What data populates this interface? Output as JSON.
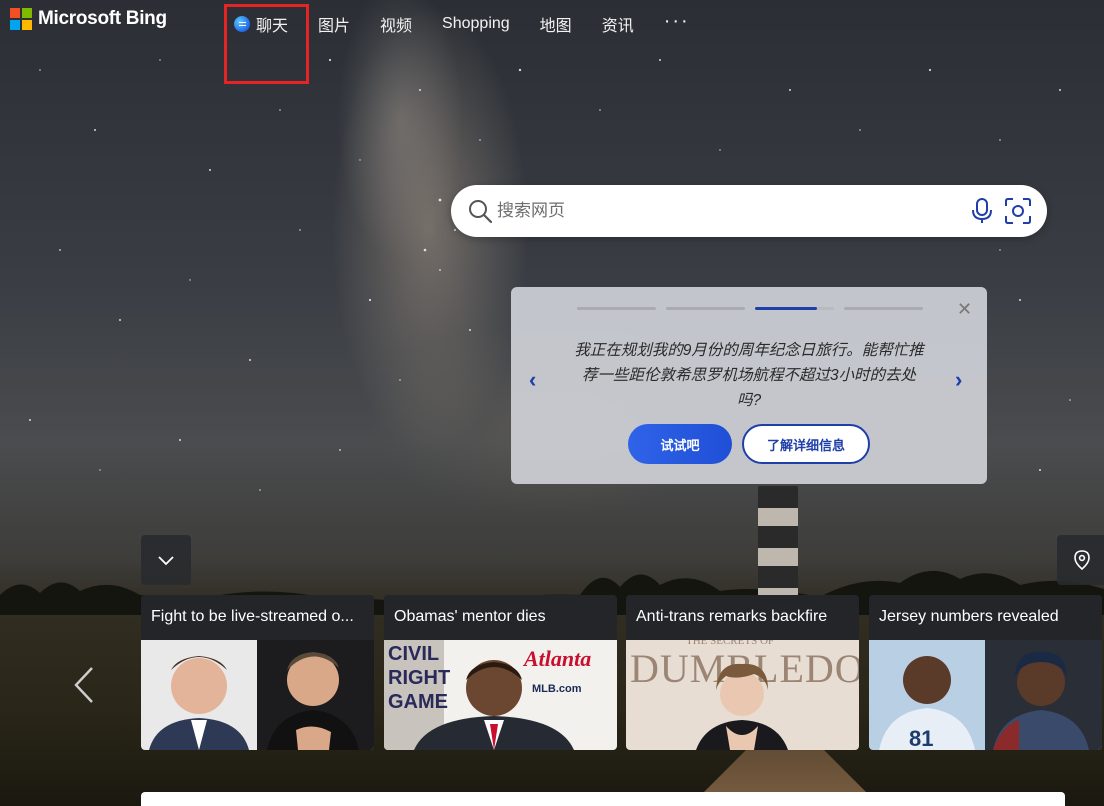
{
  "header": {
    "brand": "Microsoft Bing",
    "nav": [
      {
        "label": "聊天",
        "icon": "chat-icon"
      },
      {
        "label": "图片"
      },
      {
        "label": "视频"
      },
      {
        "label": "Shopping"
      },
      {
        "label": "地图"
      },
      {
        "label": "资讯"
      },
      {
        "label": "···",
        "icon": "more-icon"
      }
    ]
  },
  "search": {
    "placeholder": "搜索网页",
    "value": ""
  },
  "promo": {
    "progress_segments": 4,
    "active_segment": 3,
    "text": "我正在规划我的9月份的周年纪念日旅行。能帮忙推荐一些距伦敦希思罗机场航程不超过3小时的去处吗?",
    "primary_button": "试试吧",
    "secondary_button": "了解详细信息"
  },
  "news": [
    {
      "title": "Fight to be live-streamed o..."
    },
    {
      "title": "Obamas' mentor dies"
    },
    {
      "title": "Anti-trans remarks backfire"
    },
    {
      "title": "Jersey numbers revealed"
    }
  ],
  "colors": {
    "accent": "#1f3fa8",
    "button_blue": "#2f63e8",
    "highlight_red": "#e52525",
    "logo": [
      "#f25022",
      "#7fba00",
      "#00a4ef",
      "#ffb900"
    ]
  }
}
